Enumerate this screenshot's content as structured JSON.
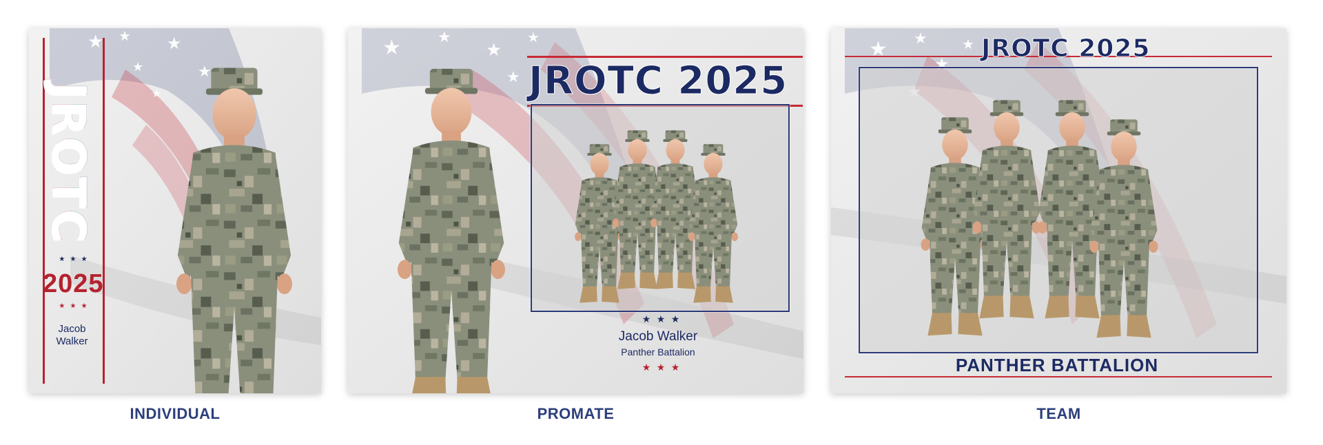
{
  "colors": {
    "navy": "#1c2a63",
    "red": "#b5222e",
    "caption": "#2c3f7c"
  },
  "individual": {
    "title": "JROTC",
    "year": "2025",
    "first_name": "Jacob",
    "last_name": "Walker",
    "caption": "INDIVIDUAL"
  },
  "promate": {
    "title_left": "JROTC",
    "title_right": "2025",
    "name": "Jacob Walker",
    "unit": "Panther Battalion",
    "caption": "PROMATE"
  },
  "team": {
    "title_left": "JROTC",
    "title_right": "2025",
    "unit": "PANTHER BATTALION",
    "caption": "TEAM"
  },
  "icons": [
    "flag-background",
    "star-icon",
    "soldier-photo"
  ]
}
